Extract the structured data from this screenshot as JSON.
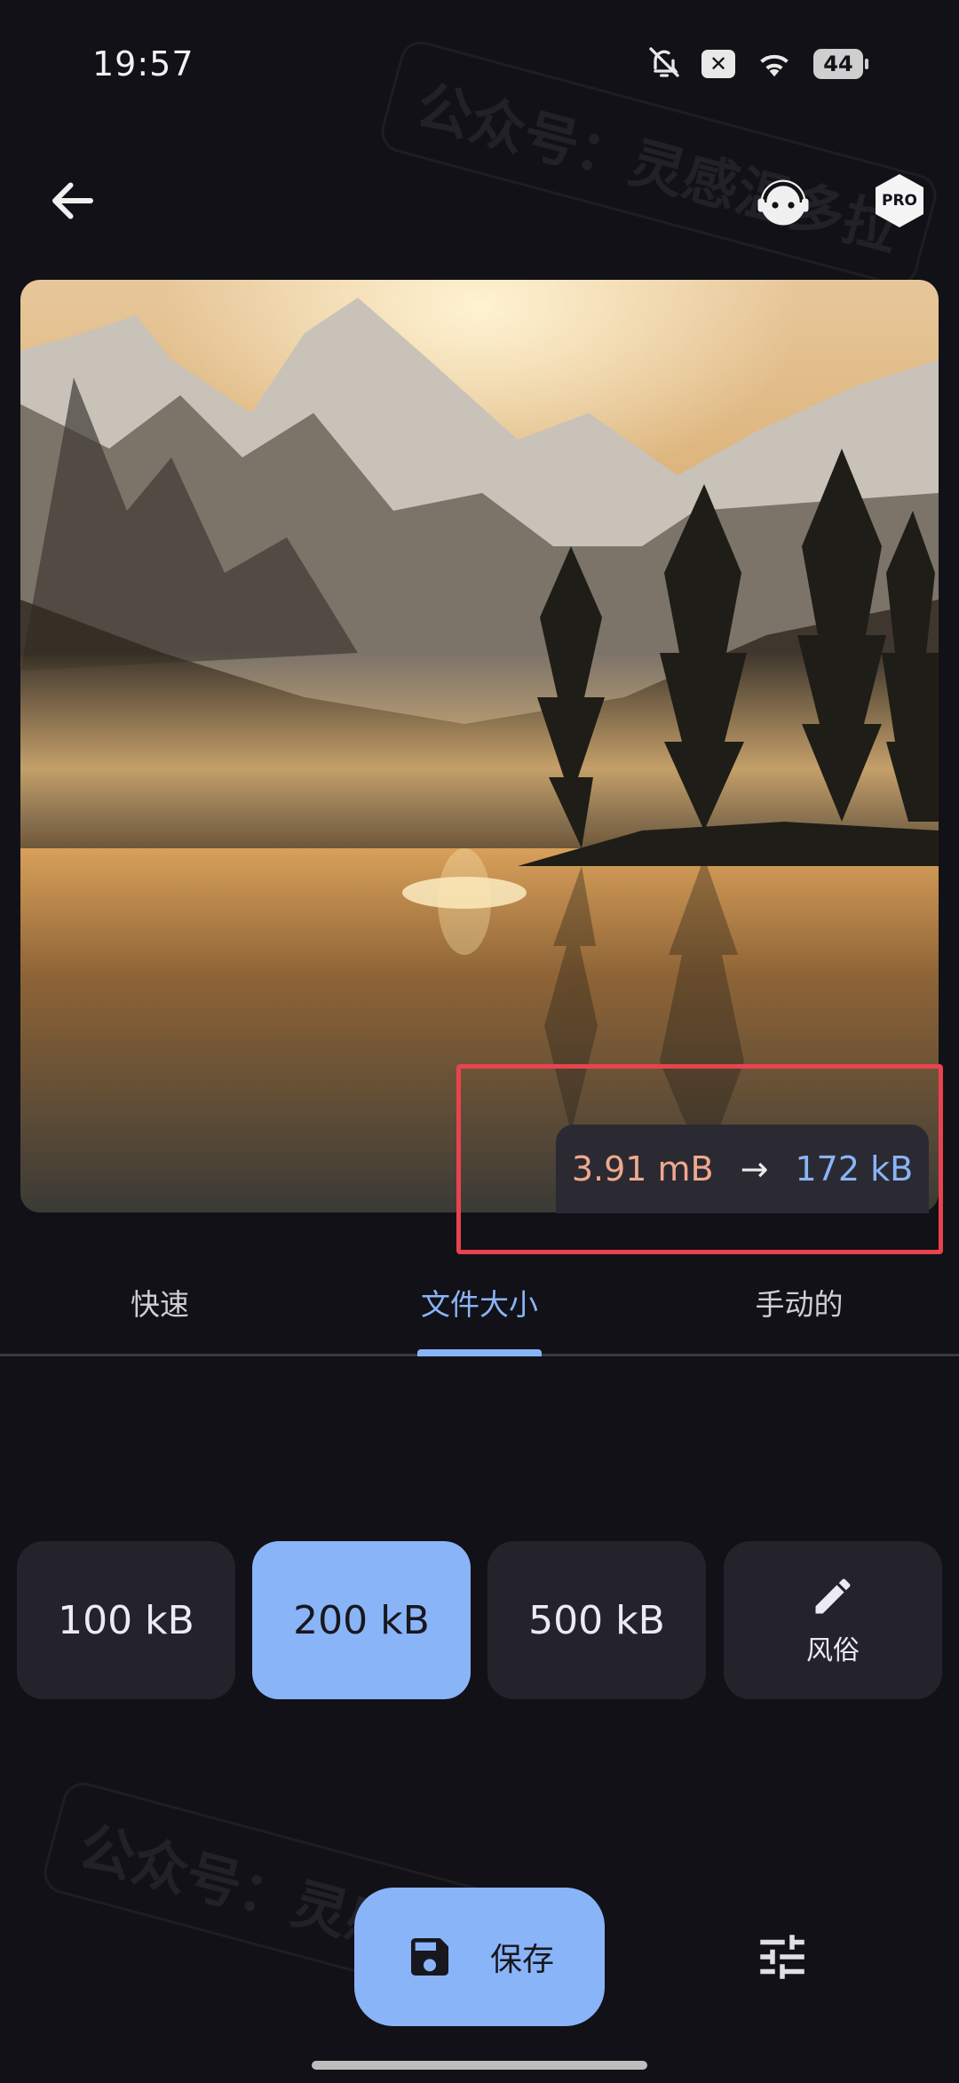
{
  "status_bar": {
    "time": "19:57",
    "battery": "44"
  },
  "top_bar": {
    "pro_label": "PRO"
  },
  "image": {
    "original_size": "3.91 mB",
    "arrow": "→",
    "compressed_size": "172 kB"
  },
  "tabs": [
    {
      "label": "快速",
      "active": false
    },
    {
      "label": "文件大小",
      "active": true
    },
    {
      "label": "手动的",
      "active": false
    }
  ],
  "size_options": [
    {
      "label": "100 kB",
      "selected": false
    },
    {
      "label": "200 kB",
      "selected": true
    },
    {
      "label": "500 kB",
      "selected": false
    },
    {
      "label": "风俗",
      "icon": "pencil-icon",
      "selected": false
    }
  ],
  "bottom_bar": {
    "save_label": "保存"
  },
  "watermark": {
    "text": "公众号：灵感温多拉"
  },
  "colors": {
    "accent": "#8ab4f8",
    "background": "#121117",
    "highlight": "#e8434f",
    "original_size": "#f0a98e"
  }
}
